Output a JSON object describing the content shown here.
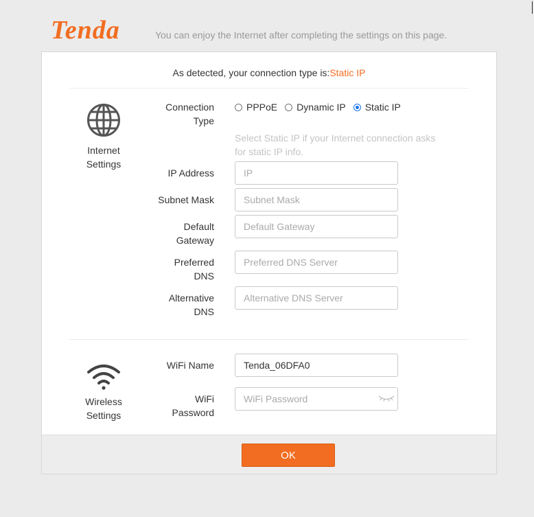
{
  "header": {
    "logo_text": "Tenda",
    "tagline": "You can enjoy the Internet after completing the settings on this page."
  },
  "detection": {
    "prefix": "As detected, your connection type is:",
    "value": "Static IP"
  },
  "internet": {
    "section_label_1": "Internet",
    "section_label_2": "Settings",
    "icon": "globe-icon",
    "connection_type_label_1": "Connection",
    "connection_type_label_2": "Type",
    "options": [
      {
        "label": "PPPoE",
        "selected": false
      },
      {
        "label": "Dynamic IP",
        "selected": false
      },
      {
        "label": "Static IP",
        "selected": true
      }
    ],
    "hint_line_1": "Select Static IP if your Internet connection asks",
    "hint_line_2": "for static IP info.",
    "fields": {
      "ip": {
        "label": "IP Address",
        "placeholder": "IP",
        "value": ""
      },
      "mask": {
        "label": "Subnet Mask",
        "placeholder": "Subnet Mask",
        "value": ""
      },
      "gateway": {
        "label_1": "Default",
        "label_2": "Gateway",
        "placeholder": "Default Gateway",
        "value": ""
      },
      "dns1": {
        "label_1": "Preferred",
        "label_2": "DNS",
        "placeholder": "Preferred DNS Server",
        "value": ""
      },
      "dns2": {
        "label_1": "Alternative",
        "label_2": "DNS",
        "placeholder": "Alternative DNS Server",
        "value": ""
      }
    }
  },
  "wireless": {
    "section_label_1": "Wireless",
    "section_label_2": "Settings",
    "icon": "wifi-icon",
    "wifi_name": {
      "label": "WiFi Name",
      "value": "Tenda_06DFA0",
      "placeholder": ""
    },
    "wifi_password": {
      "label_1": "WiFi",
      "label_2": "Password",
      "placeholder": "WiFi Password",
      "value": "",
      "toggle_icon": "eye-closed-icon"
    }
  },
  "footer": {
    "ok_label": "OK"
  },
  "colors": {
    "brand": "#f26d21",
    "radio_selected": "#1a73e8",
    "background": "#ebebeb"
  }
}
